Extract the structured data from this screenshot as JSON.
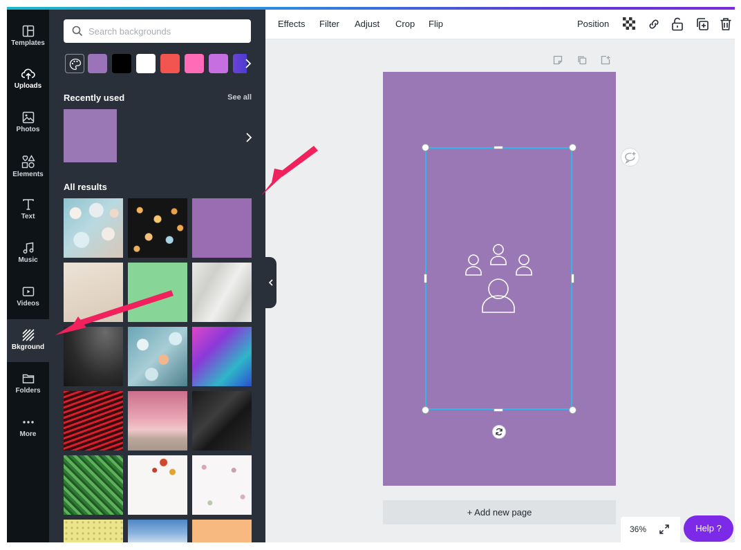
{
  "rail": {
    "items": [
      {
        "label": "Templates",
        "icon": "templates-icon"
      },
      {
        "label": "Uploads",
        "icon": "upload-cloud-icon"
      },
      {
        "label": "Photos",
        "icon": "photo-icon"
      },
      {
        "label": "Elements",
        "icon": "shapes-icon"
      },
      {
        "label": "Text",
        "icon": "text-t-icon"
      },
      {
        "label": "Music",
        "icon": "music-note-icon"
      },
      {
        "label": "Videos",
        "icon": "video-play-icon"
      },
      {
        "label": "Bkground",
        "icon": "background-stripes-icon"
      },
      {
        "label": "Folders",
        "icon": "folder-icon"
      },
      {
        "label": "More",
        "icon": "more-dots-icon"
      }
    ],
    "active": "Bkground"
  },
  "panel": {
    "search_placeholder": "Search backgrounds",
    "swatch_colors": [
      "#9b73b8",
      "#000000",
      "#ffffff",
      "#f2554f",
      "#ff6bb6",
      "#c56fe0",
      "#6b43d8"
    ],
    "recently_used_title": "Recently used",
    "see_all": "See all",
    "recent_color": "#9a77b5",
    "all_results_title": "All results"
  },
  "toolbar": {
    "effects": "Effects",
    "filter": "Filter",
    "adjust": "Adjust",
    "crop": "Crop",
    "flip": "Flip",
    "position": "Position",
    "icons": [
      "transparency-checker-icon",
      "link-icon",
      "unlock-icon",
      "duplicate-icon",
      "trash-icon"
    ]
  },
  "canvas": {
    "page_color": "#9a77b5",
    "add_page": "+ Add new page",
    "zoom": "36%"
  },
  "help": {
    "label": "Help",
    "glyph": "?"
  },
  "colors": {
    "accent_purple": "#7d2ae8",
    "selection_blue": "#35b6e8",
    "annotation_arrow": "#f0215c"
  }
}
